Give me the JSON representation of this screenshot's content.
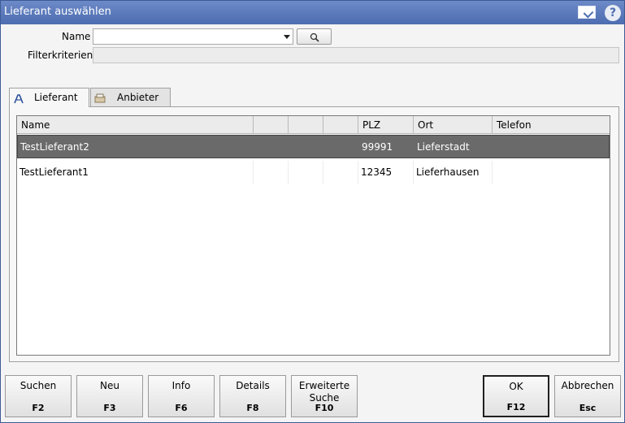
{
  "window": {
    "title": "Lieferant auswählen",
    "icons": [
      "document-check-icon",
      "help-icon"
    ],
    "help_glyph": "?"
  },
  "filter": {
    "name_label": "Name",
    "name_value": "",
    "filter_label": "Filterkriterien",
    "filter_value": ""
  },
  "tabs": [
    {
      "label": "Lieferant",
      "icon": "supplier-icon",
      "active": true
    },
    {
      "label": "Anbieter",
      "icon": "provider-icon",
      "active": false
    }
  ],
  "table": {
    "columns": [
      "Name",
      "",
      "",
      "",
      "PLZ",
      "Ort",
      "Telefon"
    ],
    "rows": [
      {
        "name": "TestLieferant2",
        "c2": "",
        "c3": "",
        "c4": "",
        "plz": "99991",
        "ort": "Lieferstadt",
        "telefon": "",
        "selected": true
      },
      {
        "name": "TestLieferant1",
        "c2": "",
        "c3": "",
        "c4": "",
        "plz": "12345",
        "ort": "Lieferhausen",
        "telefon": "",
        "selected": false
      }
    ]
  },
  "buttons": [
    {
      "label": "Suchen",
      "key": "F2"
    },
    {
      "label": "Neu",
      "key": "F3"
    },
    {
      "label": "Info",
      "key": "F6"
    },
    {
      "label": "Details",
      "key": "F8"
    },
    {
      "label": "Erweiterte Suche",
      "key": "F10"
    },
    {
      "label": "OK",
      "key": "F12"
    },
    {
      "label": "Abbrechen",
      "key": "Esc"
    }
  ],
  "colors": {
    "titlebar": "#4c6db0",
    "selected_row": "#6a6a6a"
  }
}
